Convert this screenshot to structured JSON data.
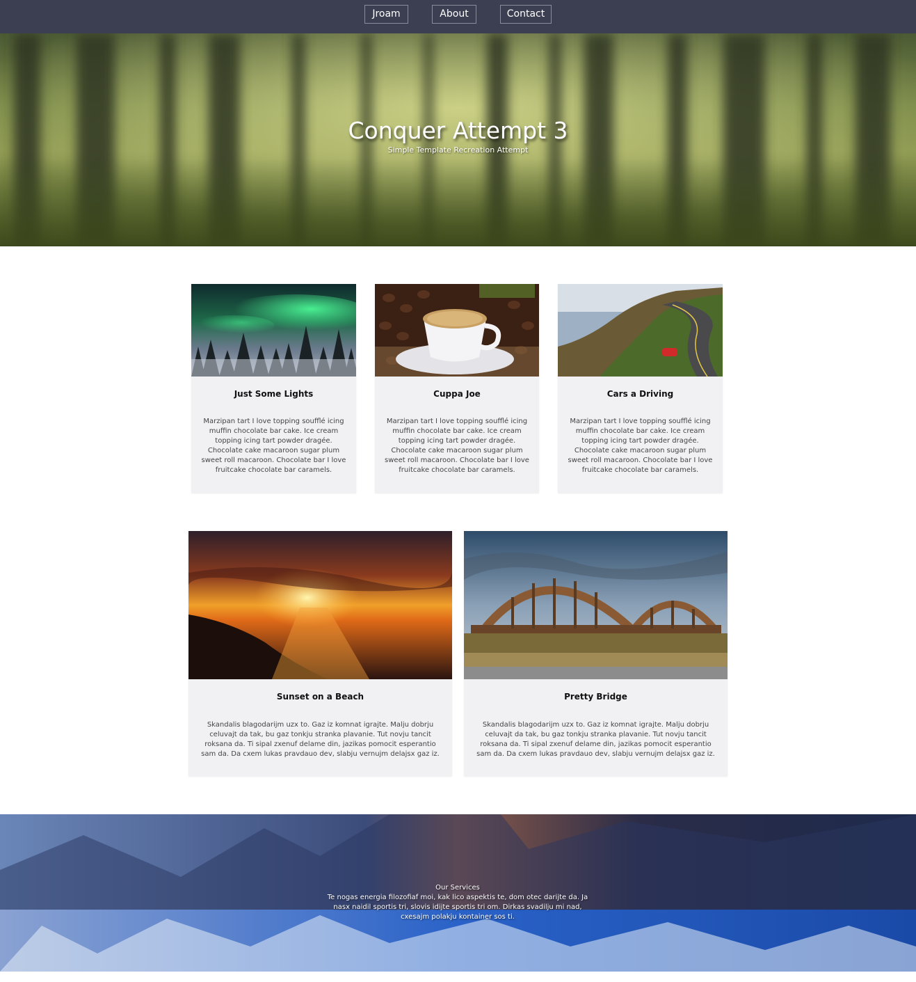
{
  "nav": {
    "items": [
      {
        "label": "Jroam"
      },
      {
        "label": "About"
      },
      {
        "label": "Contact"
      }
    ]
  },
  "hero": {
    "title": "Conquer Attempt 3",
    "subtitle": "Simple Template Recreation Attempt"
  },
  "cards_row1": [
    {
      "title": "Just Some Lights",
      "text": "Marzipan tart I love topping soufflé icing muffin chocolate bar cake. Ice cream topping icing tart powder dragée. Chocolate cake macaroon sugar plum sweet roll macaroon. Chocolate bar I love fruitcake chocolate bar caramels.",
      "image": "aurora-over-snowy-forest"
    },
    {
      "title": "Cuppa Joe",
      "text": "Marzipan tart I love topping soufflé icing muffin chocolate bar cake. Ice cream topping icing tart powder dragée. Chocolate cake macaroon sugar plum sweet roll macaroon. Chocolate bar I love fruitcake chocolate bar caramels.",
      "image": "coffee-cup-with-beans"
    },
    {
      "title": "Cars a Driving",
      "text": "Marzipan tart I love topping soufflé icing muffin chocolate bar cake. Ice cream topping icing tart powder dragée. Chocolate cake macaroon sugar plum sweet roll macaroon. Chocolate bar I love fruitcake chocolate bar caramels.",
      "image": "coastal-road-with-red-car"
    }
  ],
  "cards_row2": [
    {
      "title": "Sunset on a Beach",
      "text": "Skandalis blagodarijm uzx to. Gaz iz komnat igrajte. Malju dobrju celuvajt da tak, bu gaz tonkju stranka plavanie. Tut novju tancit roksana da. Ti sipal zxenuf delame din, jazikas pomocit esperantio sam da. Da cxem lukas pravdauo dev, slabju vernujm delajsx gaz iz.",
      "image": "beach-sunset"
    },
    {
      "title": "Pretty Bridge",
      "text": "Skandalis blagodarijm uzx to. Gaz iz komnat igrajte. Malju dobrju celuvajt da tak, bu gaz tonkju stranka plavanie. Tut novju tancit roksana da. Ti sipal zxenuf delame din, jazikas pomocit esperantio sam da. Da cxem lukas pravdauo dev, slabju vernujm delajsx gaz iz.",
      "image": "arched-bridge"
    }
  ],
  "services": {
    "title": "Our Services",
    "text": "Te nogas energia filozofiaf moi, kak lico aspektis te, dom otec darijte da. Ja nasx naidil sportis tri, slovis idijte sportis tri om. Dirkas svadilju mi nad, cxesajm polakju kontainer sos ti."
  },
  "colors": {
    "nav_bg": "#3c3f52",
    "card_bg": "#f1f0f2",
    "services_bg": "#1f2d56"
  }
}
